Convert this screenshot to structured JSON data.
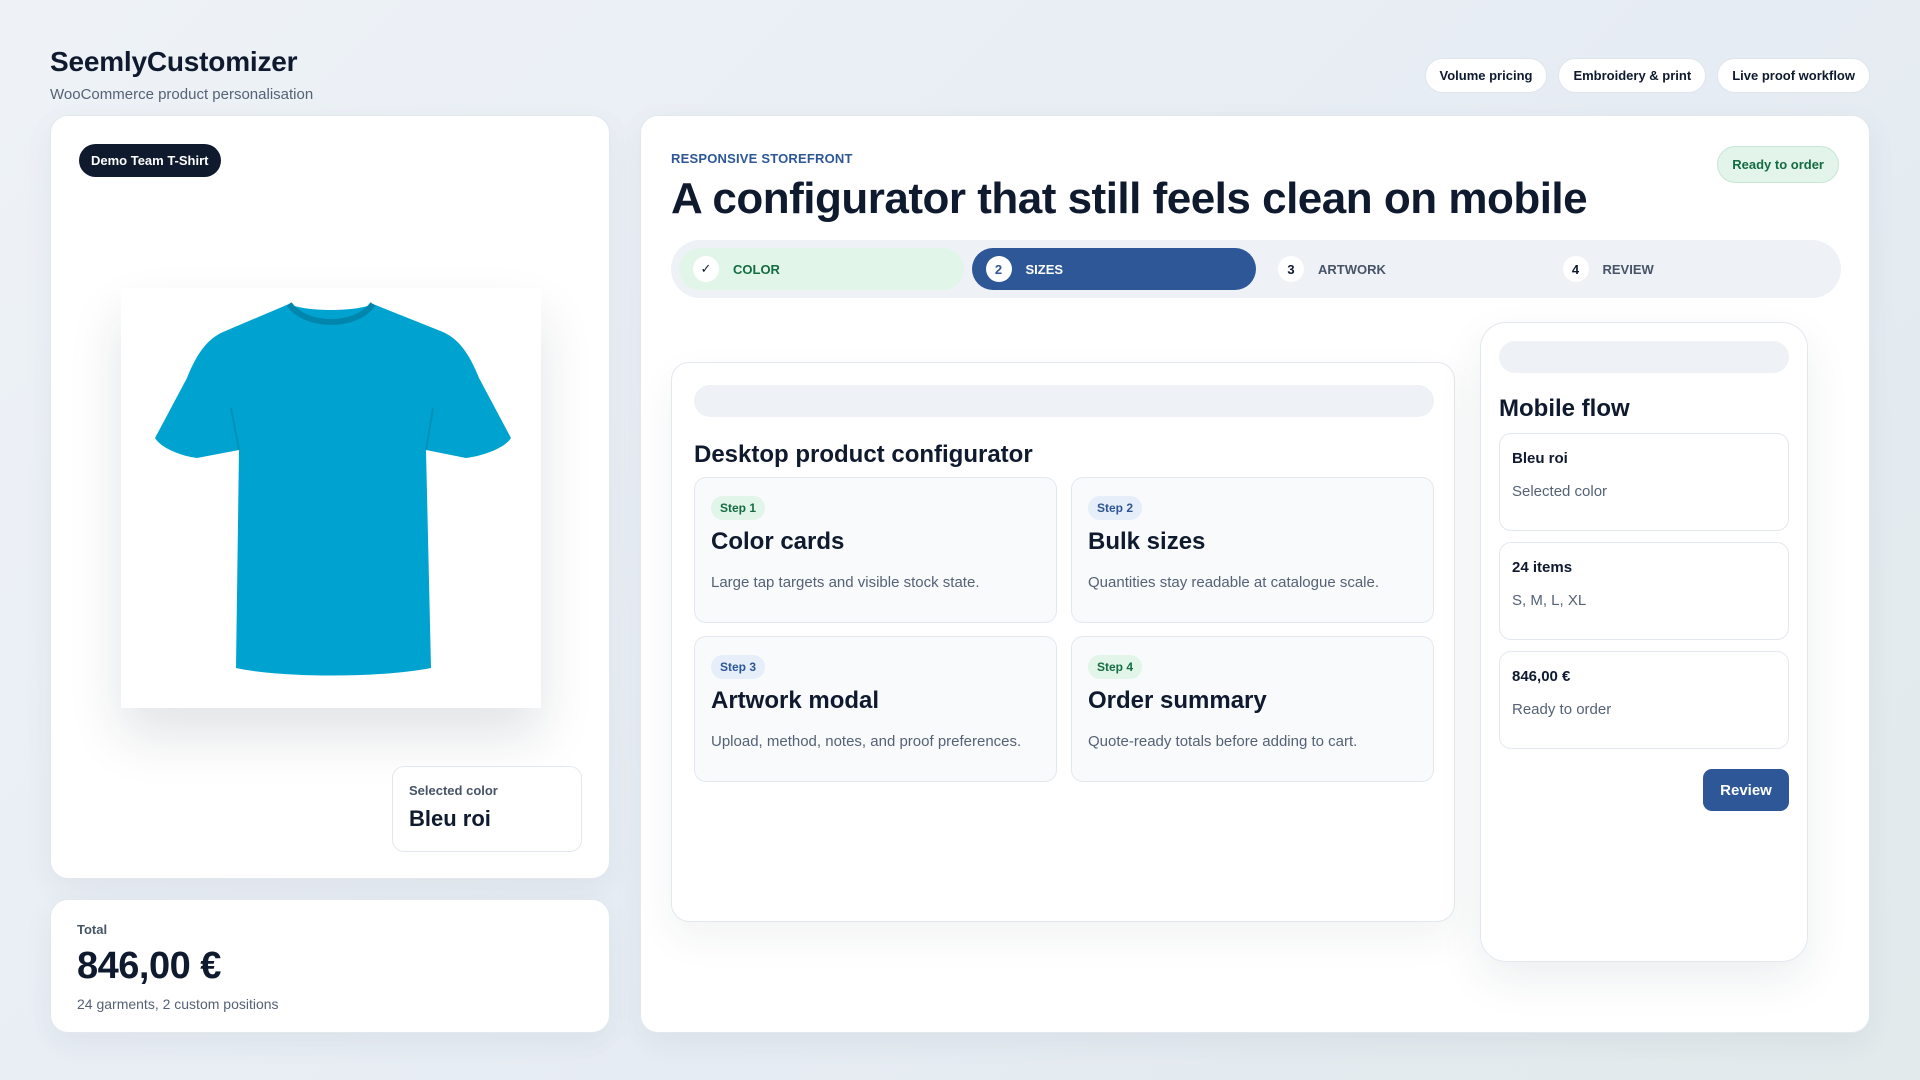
{
  "brand": {
    "title": "SeemlyCustomizer",
    "subtitle": "WooCommerce product personalisation"
  },
  "top_pills": [
    "Volume pricing",
    "Embroidery & print",
    "Live proof workflow"
  ],
  "product": {
    "tag": "Demo Team T-Shirt",
    "image_icon": "tshirt-image",
    "shirt_color": "#00a3cf",
    "selected_color_label": "Selected color",
    "selected_color_value": "Bleu roi"
  },
  "total": {
    "label": "Total",
    "value": "846,00 €",
    "sub": "24 garments, 2 custom positions"
  },
  "main": {
    "kicker": "RESPONSIVE STOREFRONT",
    "title": "A configurator that still feels clean on mobile",
    "status_badge": "Ready to order",
    "steps": [
      {
        "num": "✓",
        "label": "COLOR",
        "state": "done"
      },
      {
        "num": "2",
        "label": "SIZES",
        "state": "active"
      },
      {
        "num": "3",
        "label": "ARTWORK",
        "state": "pending"
      },
      {
        "num": "4",
        "label": "REVIEW",
        "state": "pending"
      }
    ]
  },
  "desktop": {
    "title": "Desktop product configurator",
    "features": [
      {
        "step": "Step 1",
        "title": "Color cards",
        "desc": "Large tap targets and visible stock state."
      },
      {
        "step": "Step 2",
        "title": "Bulk sizes",
        "desc": "Quantities stay readable at catalogue scale."
      },
      {
        "step": "Step 3",
        "title": "Artwork modal",
        "desc": "Upload, method, notes, and proof preferences."
      },
      {
        "step": "Step 4",
        "title": "Order summary",
        "desc": "Quote-ready totals before adding to cart."
      }
    ]
  },
  "mobile": {
    "title": "Mobile flow",
    "items": [
      {
        "title": "Bleu roi",
        "sub": "Selected color"
      },
      {
        "title": "24 items",
        "sub": "S, M, L, XL"
      },
      {
        "title": "846,00 €",
        "sub": "Ready to order"
      }
    ],
    "review_label": "Review"
  },
  "colors": {
    "accent_blue": "#2d5796",
    "success_green": "#146c43",
    "dark": "#0f1a2e"
  }
}
